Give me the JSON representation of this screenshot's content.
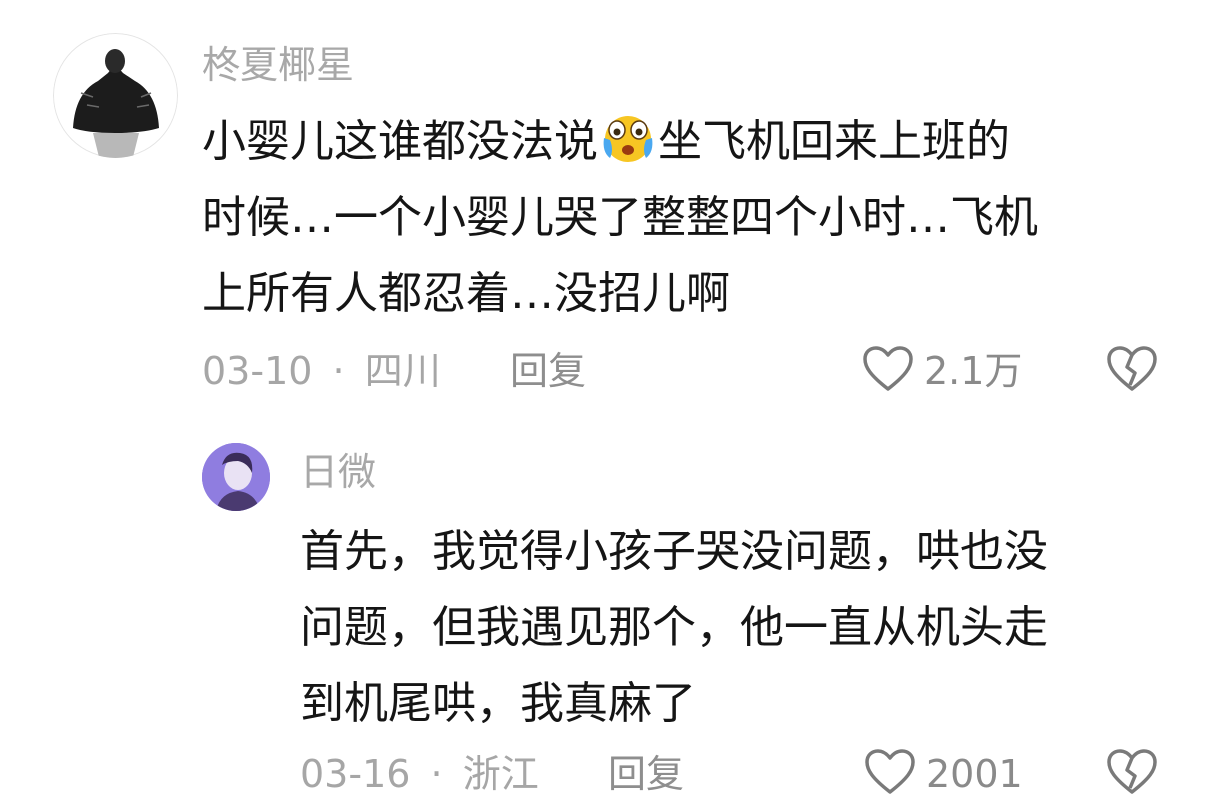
{
  "comments": [
    {
      "username": "柊夏椰星",
      "text_lines": [
        [
          "小婴儿这谁都没法说",
          "坐飞机回来上班的"
        ],
        "时候…一个小婴儿哭了整整四个小时…飞机",
        "上所有人都忍着…没招儿啊"
      ],
      "emoji_icon": "crying-laughing-emoji",
      "date": "03-10",
      "separator": "·",
      "location": "四川",
      "reply_label": "回复",
      "like_count": "2.1万"
    },
    {
      "username": "日微",
      "text_lines": [
        "首先，我觉得小孩子哭没问题，哄也没",
        "问题，但我遇见那个，他一直从机头走",
        "到机尾哄，我真麻了"
      ],
      "date": "03-16",
      "separator": "·",
      "location": "浙江",
      "reply_label": "回复",
      "like_count": "2001"
    }
  ],
  "colors": {
    "username": "#a8a8a8",
    "body": "#151515",
    "meta": "#a6a6a6",
    "icon": "#7a7a7a"
  }
}
